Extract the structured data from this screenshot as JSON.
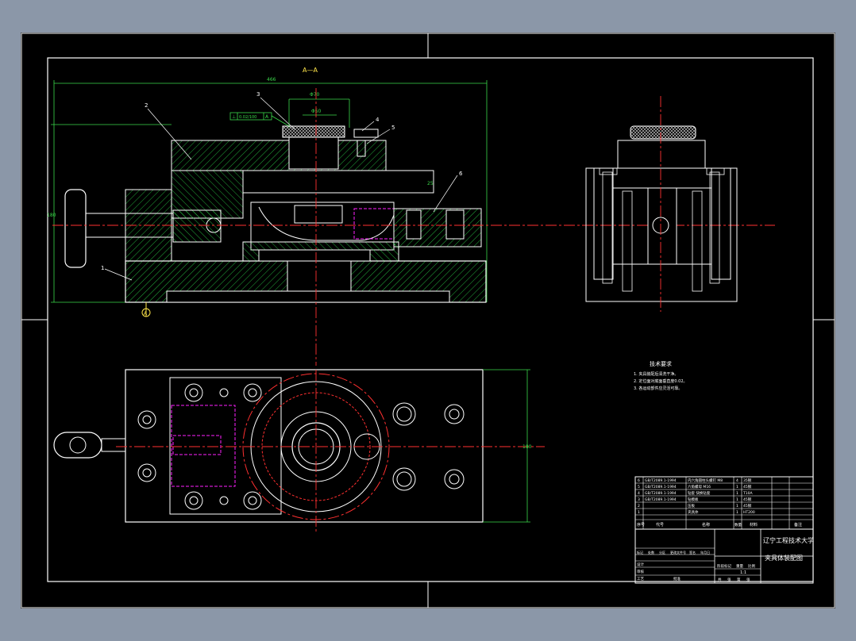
{
  "drawing": {
    "section_label": "A—A",
    "overall_length_dim": "466",
    "height_dim": "180",
    "width_dim": "180",
    "bore_dim_outer": "Φ70",
    "bore_dim_inner": "Φ50",
    "gap_dim": "25",
    "datum_label": "A",
    "tolerance_frame": [
      "⊥",
      "0.02/100",
      "A"
    ],
    "balloons": [
      "1",
      "2",
      "3",
      "4",
      "5",
      "6"
    ]
  },
  "notes": {
    "title": "技术要求",
    "items": [
      "1. 夹具装配后清洗干净。",
      "2. 定位面对底面垂直度0.02。",
      "3. 各运动部件应灵活可靠。"
    ]
  },
  "parts_list": {
    "rows": [
      {
        "no": "6",
        "code": "GB/T2089.1-1994",
        "name": "内六角圆柱头螺钉 M8",
        "qty": "4",
        "material": "35钢",
        "note": ""
      },
      {
        "no": "5",
        "code": "GB/T2089.1-1994",
        "name": "六角螺母 M16",
        "qty": "1",
        "material": "45钢",
        "note": ""
      },
      {
        "no": "4",
        "code": "GB/T2089.1-1994",
        "name": "钻套 快换钻套",
        "qty": "1",
        "material": "T10A",
        "note": ""
      },
      {
        "no": "3",
        "code": "GB/T2089.1-1994",
        "name": "钻模板",
        "qty": "1",
        "material": "45钢",
        "note": ""
      },
      {
        "no": "2",
        "code": "",
        "name": "压板",
        "qty": "1",
        "material": "45钢",
        "note": ""
      },
      {
        "no": "1",
        "code": "",
        "name": "夹具体",
        "qty": "1",
        "material": "HT200",
        "note": ""
      }
    ],
    "headers": {
      "no": "序号",
      "code": "代号",
      "name": "名称",
      "qty": "数量",
      "material": "材料",
      "note": "备注"
    }
  },
  "title_block": {
    "school": "辽宁工程技术大学",
    "drawing_name": "夹具体装配图",
    "scale": "1:1",
    "row_labels": [
      "标记",
      "处数",
      "分区",
      "更改文件号",
      "签名",
      "年月日"
    ],
    "role_labels": [
      "设计",
      "审核",
      "工艺",
      "批准"
    ],
    "stage_labels": [
      "阶段标记",
      "重量",
      "比例"
    ],
    "sheet_labels": [
      "共",
      "张",
      "第",
      "张"
    ]
  },
  "colors": {
    "sheet": "#000000",
    "line": "#ffffff",
    "hatch": "#2bd94a",
    "center": "#ff3030",
    "hidden": "#ff20ff",
    "dim": "#3ad84a",
    "frame": "#ffffff"
  }
}
